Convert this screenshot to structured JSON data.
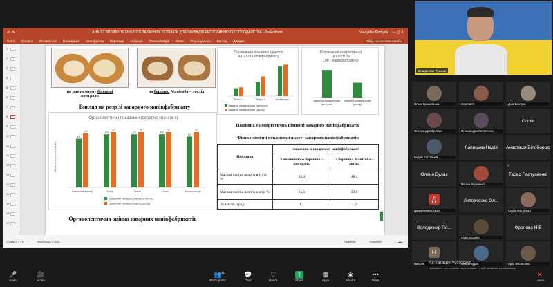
{
  "ppt": {
    "window_title": "АНАЛІЗ ВПЛИВУ ТЕХНОЛОГІЇ ЗАВАРНИХ ТІСТЕЧОК ДЛЯ ЗАКЛАДІВ РЕСТОРАННОГО ГОСПОДАРСТВА - PowerPoint",
    "user": "Vladyslav Pomyna",
    "ribbon_tabs": [
      "Файл",
      "Основне",
      "Вставлення",
      "Малювання",
      "Конструктор",
      "Переходи",
      "Анімація",
      "Показ слайдів",
      "Запис",
      "Рецензування",
      "Вигляд",
      "Довідка"
    ],
    "ribbon_right": "Обіць ченнестіле спроби",
    "slide_numbers": [
      "1",
      "2",
      "3",
      "4",
      "5",
      "6",
      "7",
      "8",
      "9",
      "10",
      "11",
      "12",
      "13",
      "14",
      "15",
      "16",
      "17",
      "18",
      "19"
    ],
    "status": {
      "slide": "Слайд 8 з 19",
      "lang": "Англійська (США)",
      "notes": "Примітки",
      "comments": "Примітки"
    }
  },
  "slide": {
    "caption_left_1": "на пшеничному",
    "caption_left_2": "борошні",
    "caption_left_3": "контроль",
    "caption_right_1": "на",
    "caption_right_2": "борошні",
    "caption_right_3": "Манітоба – дослід",
    "cut_title": "Вигляд на розрізі заварного напівфабрикату",
    "organo_title": "Органолептична оцінка заварних напівфабрикатів",
    "nutri_title": "Поживна та енергетична цінності заварних напівфабрикатів",
    "phys_title": "Фізико-хімічні показники якості заварних напівфабрикатів",
    "table": {
      "h_indicator": "Показник",
      "h_values": "Значення в заварному напівфабрикаті",
      "h_control": "З пшеничного борошна – контроль",
      "h_test": "З борошна Манітоба – дослід",
      "rows": [
        {
          "name": "Масова частка вологи в тісті, %",
          "control": "43,4",
          "test": "48,4"
        },
        {
          "name": "Масова частка вологи в н/ф, %",
          "control": "23,6",
          "test": "23,6"
        },
        {
          "name": "Лужність, град.",
          "control": "1,2",
          "test": "1,2"
        }
      ]
    }
  },
  "chart_data": [
    {
      "type": "bar",
      "title": "Органолептичні показники (середнє значення)",
      "categories": [
        "Зовнішній вигляд",
        "Колір",
        "Запах",
        "Смак",
        "Консистенція"
      ],
      "series": [
        {
          "name": "Заварний напівфабрикат (контроль)",
          "color": "#2e8b3e",
          "values": [
            4.4,
            4.8,
            4.8,
            4.8,
            4.6
          ]
        },
        {
          "name": "Заварний напівфабрикат (дослід)",
          "color": "#e86b1f",
          "values": [
            4.9,
            5.0,
            5.0,
            5.0,
            5.0
          ]
        }
      ],
      "ylim": [
        0,
        5.5
      ],
      "ylabel": "Органолептична оцінка"
    },
    {
      "type": "bar",
      "title": "Порівняння поживної цінності на 100 г напівфабрикату",
      "categories": [
        "Білки, г",
        "Жири, г",
        "Вуглеводи, г"
      ],
      "series": [
        {
          "name": "Заварний напівфабрикат (контроль)",
          "color": "#2e8b3e",
          "values": [
            8,
            14,
            30
          ]
        },
        {
          "name": "Заварний напівфабрикат (дослід)",
          "color": "#e86b1f",
          "values": [
            9,
            20,
            32
          ]
        }
      ],
      "ylim": [
        0,
        35
      ]
    },
    {
      "type": "bar",
      "title": "Порівняння енергетичної цінності на 100 г напівфабрикату",
      "categories": [
        "Заварний напівфабрикат (контроль)",
        "Заварний напівфабрикат (дослід)"
      ],
      "series": [
        {
          "name": "Енергетична цінність",
          "color": "#2e8b3e",
          "values": [
            260,
            140
          ]
        }
      ],
      "ylim": [
        0,
        300
      ]
    }
  ],
  "speaker": {
    "name": "Владислав Пушкар"
  },
  "participants": [
    {
      "label": "Ольга Крашевська",
      "kind": "photo",
      "color": "#7a6a5a"
    },
    {
      "label": "Зоряна Ю",
      "kind": "photo",
      "color": "#8a5a4a"
    },
    {
      "label": "Діна Вантуха",
      "kind": "photo",
      "color": "#9a8a7a"
    },
    {
      "label": "Олександра Кірілова",
      "kind": "photo",
      "color": "#6a4a4a"
    },
    {
      "label": "Олександра Литовченко",
      "kind": "photo",
      "color": "#5a4a5a"
    },
    {
      "label": "Софія",
      "kind": "name"
    },
    {
      "label": "Вадим Заставний",
      "kind": "photo",
      "color": "#4a5a6a"
    },
    {
      "label": "Лапицька Надія",
      "kind": "name"
    },
    {
      "label": "Анастасія Білобородова",
      "kind": "name"
    },
    {
      "label": "Олена Булах",
      "kind": "name"
    },
    {
      "label": "Поліна Березенко",
      "kind": "photo",
      "color": "#a04a3a"
    },
    {
      "label": "Тарас Пастушенко",
      "kind": "name"
    },
    {
      "label": "Дворніченко Ольга",
      "kind": "avatar",
      "letter": "Д",
      "color": "#c0392b"
    },
    {
      "label": "Литовченко Ол...",
      "kind": "name"
    },
    {
      "label": "Софія Матвієнко",
      "kind": "photo",
      "color": "#8a6a5a"
    },
    {
      "label": "Володимир По...",
      "kind": "name"
    },
    {
      "label": "Юрій Косенко",
      "kind": "photo",
      "color": "#5a4a3a"
    },
    {
      "label": "Фролова Н.Е",
      "kind": "name"
    },
    {
      "label": "Наталія",
      "kind": "avatar",
      "letter": "Н",
      "color": "#7a6a5a"
    },
    {
      "label": "Любов Бурко",
      "kind": "photo",
      "color": "#4a6a8a"
    },
    {
      "label": "Лідія Беспалова",
      "kind": "photo",
      "color": "#6a5a4a"
    }
  ],
  "watermark": {
    "line1": "Активація Windows",
    "line2": "Перейдіть до розділу \"Настройки\", щоб активувати Windows."
  },
  "toolbar": [
    {
      "id": "audio",
      "label": "Audio",
      "icon": "🎤"
    },
    {
      "id": "video",
      "label": "Video",
      "icon": "🎥"
    },
    {
      "id": "participants",
      "label": "Participants",
      "icon": "👥",
      "count": "21"
    },
    {
      "id": "chat",
      "label": "Chat",
      "icon": "💬"
    },
    {
      "id": "react",
      "label": "React",
      "icon": "♡"
    },
    {
      "id": "share",
      "label": "Share",
      "icon": "⇧"
    },
    {
      "id": "apps",
      "label": "Apps",
      "icon": "▦"
    },
    {
      "id": "record",
      "label": "Record",
      "icon": "◉"
    },
    {
      "id": "more",
      "label": "More",
      "icon": "•••"
    },
    {
      "id": "leave",
      "label": "Leave",
      "icon": "✕"
    }
  ]
}
